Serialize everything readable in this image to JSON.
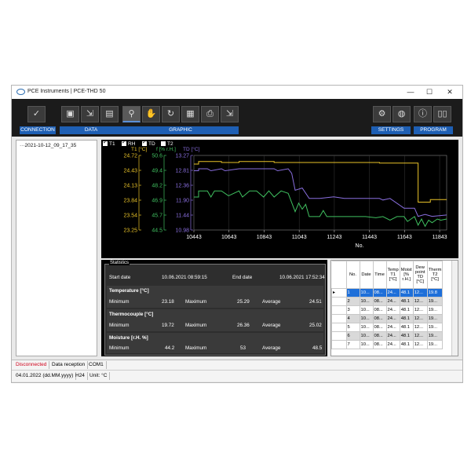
{
  "window": {
    "title": "PCE Instruments | PCE-THD 50",
    "minimize": "—",
    "maximize": "☐",
    "close": "✕"
  },
  "toolbar": {
    "groups": [
      "CONNECTION",
      "DATA",
      "GRAPHIC",
      "SETTINGS",
      "PROGRAM"
    ]
  },
  "tree": {
    "node": "2021-10-12_09_17_35"
  },
  "chart": {
    "checkboxes": [
      {
        "label": "T1",
        "checked": true
      },
      {
        "label": "RH",
        "checked": true
      },
      {
        "label": "TD",
        "checked": true
      },
      {
        "label": "T2",
        "checked": false
      }
    ],
    "axis_headers": [
      "T1 [°C]",
      "f [% r.H.]",
      "TD [°C]"
    ]
  },
  "chart_data": {
    "type": "line",
    "xlabel": "No.",
    "x_ticks": [
      "10443",
      "10643",
      "10843",
      "11043",
      "11243",
      "11443",
      "11643",
      "11843"
    ],
    "xlim": [
      10443,
      11883
    ],
    "axes": [
      {
        "name": "T1 [°C]",
        "color": "#e8c229",
        "ticks": [
          "24.72",
          "24.43",
          "24.13",
          "23.84",
          "23.54",
          "23.25"
        ],
        "ylim": [
          23.25,
          24.72
        ]
      },
      {
        "name": "f [% r.H.]",
        "color": "#3fbf5f",
        "ticks": [
          "50.6",
          "49.4",
          "48.2",
          "46.9",
          "45.7",
          "44.5"
        ],
        "ylim": [
          44.5,
          50.6
        ]
      },
      {
        "name": "TD [°C]",
        "color": "#8a6fe0",
        "ticks": [
          "13.27",
          "12.81",
          "12.36",
          "11.90",
          "11.44",
          "10.98"
        ],
        "ylim": [
          10.98,
          13.27
        ]
      }
    ],
    "series": [
      {
        "name": "T1",
        "color": "#e8c229",
        "axis": 0,
        "x": [
          10443,
          10470,
          10470,
          10600,
          10600,
          10700,
          10700,
          10900,
          10900,
          11500,
          11500,
          11700,
          11720,
          11720,
          11790,
          11790,
          11883
        ],
        "y": [
          24.55,
          24.55,
          24.6,
          24.6,
          24.58,
          24.58,
          24.6,
          24.6,
          24.58,
          24.58,
          24.57,
          24.57,
          24.57,
          23.8,
          23.8,
          23.85,
          23.85
        ]
      },
      {
        "name": "RH",
        "color": "#3fbf5f",
        "axis": 1,
        "x": [
          10443,
          10470,
          10470,
          10520,
          10540,
          10560,
          10600,
          10640,
          10700,
          10720,
          10760,
          10800,
          10840,
          10870,
          10900,
          10940,
          10980,
          11020,
          11040,
          11060,
          11080,
          11100,
          11160,
          11180,
          11200,
          11250,
          11300,
          11360,
          11420,
          11480,
          11520,
          11560,
          11600,
          11640,
          11660,
          11700,
          11720,
          11740,
          11760,
          11780,
          11800,
          11830,
          11850,
          11883
        ],
        "y": [
          47.2,
          47.2,
          47.7,
          47.7,
          47.2,
          47.7,
          47.7,
          47.3,
          47.7,
          47.2,
          47.7,
          47.7,
          47.2,
          47.7,
          47.2,
          47.7,
          47.5,
          46.0,
          46.7,
          46.2,
          46.6,
          45.6,
          45.6,
          46.1,
          45.6,
          45.6,
          45.6,
          45.6,
          45.6,
          45.5,
          45.6,
          45.3,
          45.6,
          45.6,
          45.2,
          45.6,
          44.9,
          45.4,
          44.8,
          45.3,
          45.1,
          45.4,
          45.3,
          45.4
        ]
      },
      {
        "name": "TD",
        "color": "#8a6fe0",
        "axis": 2,
        "x": [
          10443,
          10470,
          10470,
          10520,
          10540,
          10600,
          10620,
          10700,
          10720,
          10900,
          10920,
          10980,
          11000,
          11020,
          11060,
          11100,
          11160,
          11240,
          11300,
          11400,
          11500,
          11520,
          11560,
          11640,
          11700,
          11720,
          11760,
          11800,
          11883
        ],
        "y": [
          12.8,
          12.8,
          12.86,
          12.86,
          12.8,
          12.86,
          12.8,
          12.86,
          12.86,
          12.86,
          12.8,
          12.86,
          12.72,
          12.2,
          12.27,
          11.95,
          11.95,
          12.0,
          11.95,
          11.95,
          11.95,
          11.9,
          11.95,
          11.65,
          11.65,
          11.4,
          11.46,
          11.4,
          11.44
        ]
      }
    ]
  },
  "statistics": {
    "title": "Statistics",
    "start_label": "Start date",
    "start_value": "10.06.2021 08:59:15",
    "end_label": "End date",
    "end_value": "10.06.2021 17:52:34",
    "sections": [
      {
        "title": "Temperature [°C]",
        "min_label": "Minimum",
        "min": "23.18",
        "max_label": "Maximum",
        "max": "25.29",
        "avg_label": "Average",
        "avg": "24.51"
      },
      {
        "title": "Thermocouple [°C]",
        "min_label": "Minimum",
        "min": "19.72",
        "max_label": "Maximum",
        "max": "26.36",
        "avg_label": "Average",
        "avg": "25.02"
      },
      {
        "title": "Moisture [r.H. %]",
        "min_label": "Minimum",
        "min": "44.2",
        "max_label": "Maximum",
        "max": "53",
        "avg_label": "Average",
        "avg": "48.5"
      }
    ]
  },
  "table": {
    "columns": [
      "No.",
      "Date",
      "Time",
      "Temp T1 [°C]",
      "Moist [% r.H.]",
      "Dew point TD [°C]",
      "Therm T2 [°C]"
    ],
    "rows": [
      [
        "1",
        "10...",
        "08...",
        "24...",
        "48.1",
        "12...",
        "19.8"
      ],
      [
        "2",
        "10...",
        "08...",
        "24...",
        "48.1",
        "12...",
        "19..."
      ],
      [
        "3",
        "10...",
        "08...",
        "24...",
        "48.1",
        "12...",
        "19..."
      ],
      [
        "4",
        "10...",
        "08...",
        "24...",
        "48.1",
        "12...",
        "19..."
      ],
      [
        "5",
        "10...",
        "08...",
        "24...",
        "48.1",
        "12...",
        "19..."
      ],
      [
        "6",
        "10...",
        "08...",
        "24...",
        "48.1",
        "12...",
        "19..."
      ],
      [
        "7",
        "10...",
        "08...",
        "24...",
        "48.1",
        "12...",
        "19..."
      ]
    ],
    "selected_row": 0
  },
  "statusbar": {
    "connection": "Disconnected",
    "reception": "Data reception",
    "port": "COM1",
    "date": "04.01.2022 (dd.MM.yyyy)",
    "time_format": "H24",
    "unit": "Unit: °C"
  },
  "colors": {
    "accent": "#1e5fb4",
    "disconnected": "#d0021b",
    "selected_row": "#1e6fd9"
  },
  "icons": [
    "app-icon",
    "connect-icon",
    "save-icon",
    "export-icon",
    "device-icon",
    "zoom-icon",
    "pan-icon",
    "reset-icon",
    "grid-icon",
    "print-icon",
    "export-graph-icon",
    "gear-icon",
    "globe-icon",
    "info-icon",
    "book-icon"
  ]
}
